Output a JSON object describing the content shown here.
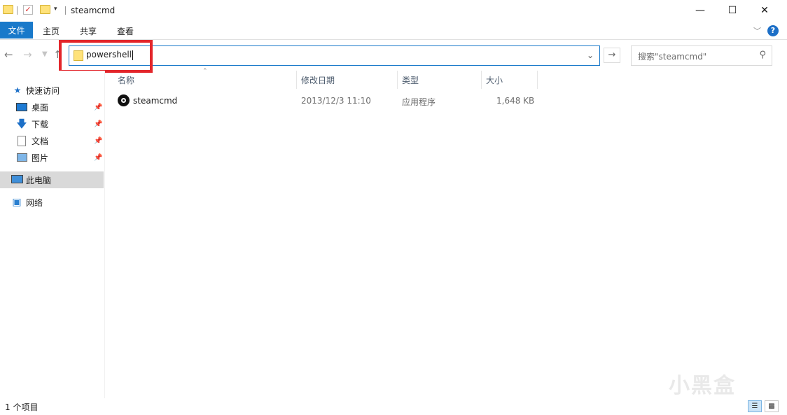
{
  "window": {
    "title": "steamcmd",
    "minimize_icon": "minimize-icon",
    "maximize_icon": "maximize-icon",
    "close_icon": "close-icon"
  },
  "ribbon": {
    "file_tab": "文件",
    "tabs": [
      "主页",
      "共享",
      "查看"
    ]
  },
  "address_bar": {
    "value": "powershell"
  },
  "search": {
    "placeholder": "搜索\"steamcmd\""
  },
  "sidebar": {
    "quick_access": "快速访问",
    "items": [
      {
        "label": "桌面",
        "icon": "desktop-icon"
      },
      {
        "label": "下载",
        "icon": "download-icon"
      },
      {
        "label": "文档",
        "icon": "documents-icon"
      },
      {
        "label": "图片",
        "icon": "pictures-icon"
      }
    ],
    "this_pc": "此电脑",
    "network": "网络"
  },
  "columns": {
    "name": "名称",
    "modified": "修改日期",
    "type": "类型",
    "size": "大小"
  },
  "files": [
    {
      "name": "steamcmd",
      "modified": "2013/12/3 11:10",
      "type": "应用程序",
      "size": "1,648 KB"
    }
  ],
  "status": {
    "item_count": "1 个项目"
  },
  "watermark": "小黑盒",
  "colors": {
    "accent": "#1979ca",
    "highlight": "#e3262b"
  }
}
